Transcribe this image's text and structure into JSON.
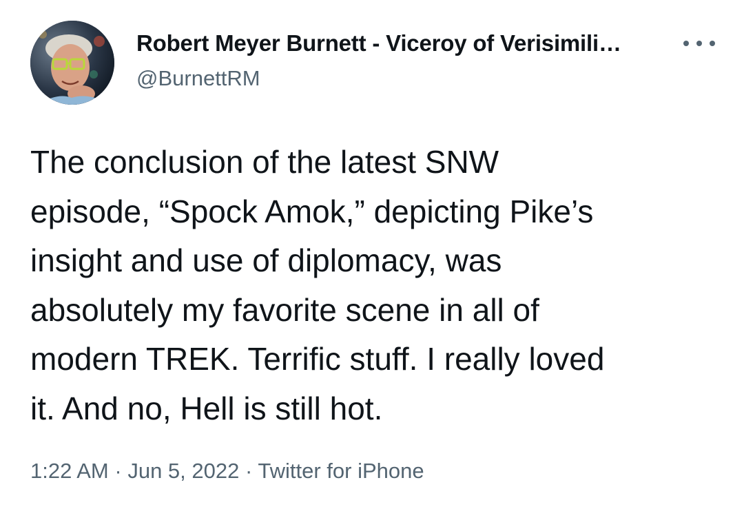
{
  "author": {
    "display_name": "Robert Meyer Burnett - Viceroy of Verisimili…",
    "handle": "@BurnettRM",
    "avatar_icon": "profile-photo"
  },
  "menu": {
    "icon": "more-options-icon"
  },
  "tweet": {
    "lines": [
      "The conclusion of the latest SNW",
      "episode, “Spock Amok,” depicting Pike’s",
      "insight and use of diplomacy, was",
      "absolutely my favorite scene in all of",
      "modern TREK. Terrific stuff. I really loved",
      "it. And no, Hell is still hot."
    ]
  },
  "meta": {
    "time": "1:22 AM",
    "separator": "·",
    "date": "Jun 5, 2022",
    "source": "Twitter for iPhone"
  },
  "colors": {
    "text_primary": "#0f1419",
    "text_secondary": "#536471",
    "background": "#ffffff"
  }
}
